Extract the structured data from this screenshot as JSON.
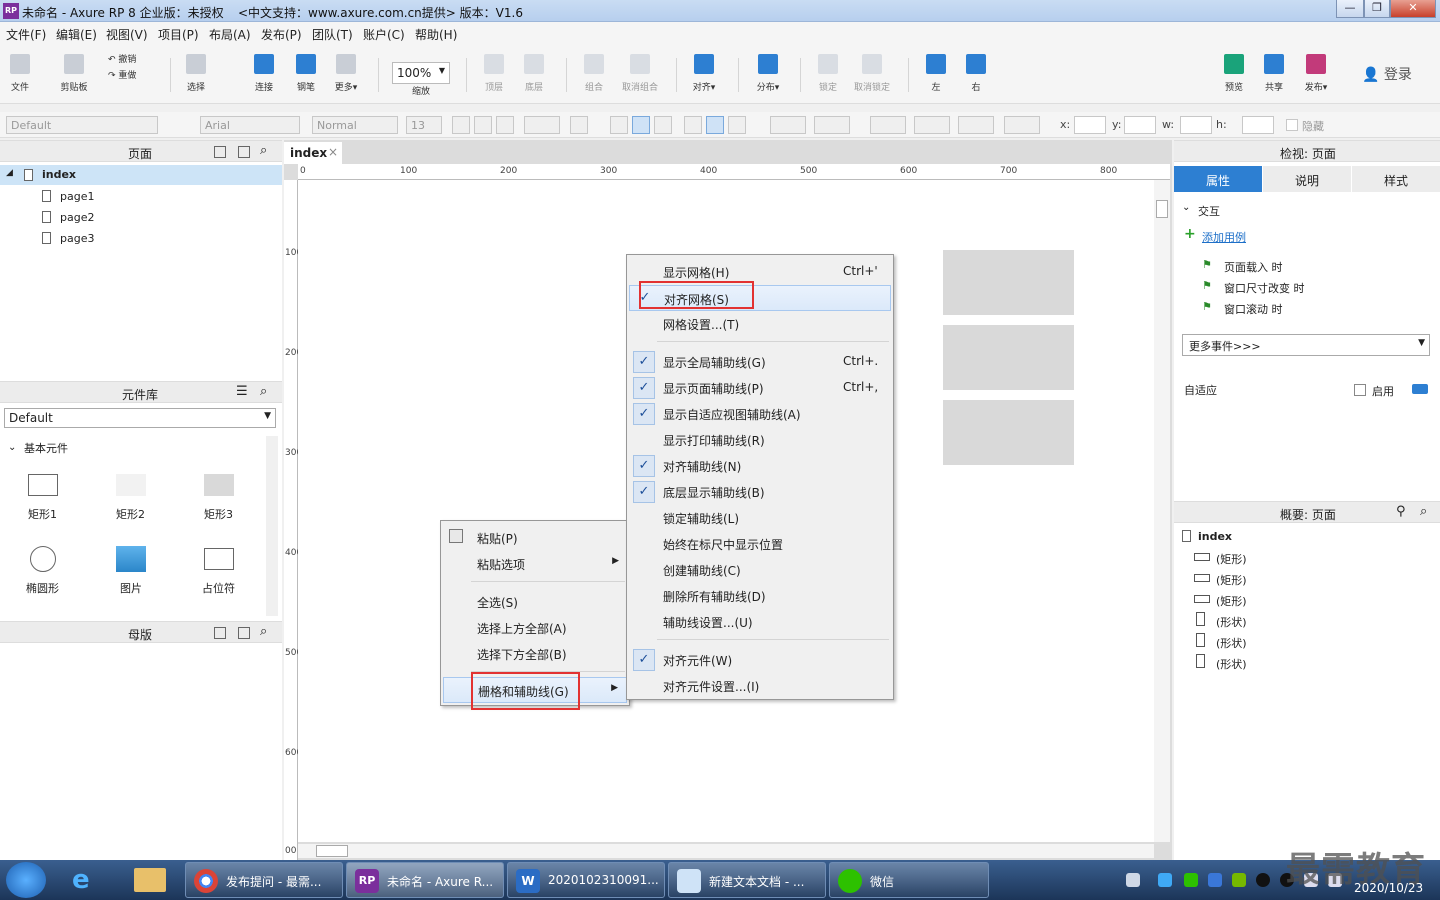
{
  "window": {
    "title": "未命名 - Axure RP 8 企业版：未授权",
    "subtitle": "<中文支持：www.axure.com.cn提供> 版本：V1.6",
    "logo": "RP"
  },
  "menu": [
    "文件(F)",
    "编辑(E)",
    "视图(V)",
    "项目(P)",
    "布局(A)",
    "发布(P)",
    "团队(T)",
    "账户(C)",
    "帮助(H)"
  ],
  "toolbar": {
    "file": "文件",
    "clipboard": "剪贴板",
    "undo": "撤销",
    "redo": "重做",
    "select": "选择",
    "connect": "连接",
    "pen": "钢笔",
    "more": "更多▾",
    "zoom": "100%",
    "zoom_label": "缩放",
    "top": "顶层",
    "bottom": "底层",
    "group": "组合",
    "ungroup": "取消组合",
    "align": "对齐▾",
    "distribute": "分布▾",
    "lock": "锁定",
    "unlock": "取消锁定",
    "left": "左",
    "right": "右",
    "preview": "预览",
    "share": "共享",
    "publish": "发布▾",
    "login": "登录"
  },
  "format": {
    "style": "Default",
    "font": "Arial",
    "weight": "Normal",
    "size": "13",
    "x": "x:",
    "y": "y:",
    "w": "w:",
    "h": "h:",
    "hide": "隐藏"
  },
  "pages": {
    "title": "页面",
    "root": "index",
    "children": [
      "page1",
      "page2",
      "page3"
    ]
  },
  "library": {
    "title": "元件库",
    "selected": "Default",
    "group": "基本元件",
    "items": [
      "矩形1",
      "矩形2",
      "矩形3",
      "椭圆形",
      "图片",
      "占位符"
    ]
  },
  "masters": {
    "title": "母版"
  },
  "canvas": {
    "tab": "index",
    "hticks": [
      "0",
      "100",
      "200",
      "300",
      "400",
      "500",
      "600",
      "700",
      "800"
    ],
    "vticks": [
      "100",
      "200",
      "300",
      "400",
      "500",
      "600",
      "00"
    ]
  },
  "context_menu": {
    "paste": "粘贴(P)",
    "paste_options": "粘贴选项",
    "select_all": "全选(S)",
    "select_above": "选择上方全部(A)",
    "select_below": "选择下方全部(B)",
    "grid_guides": "栅格和辅助线(G)"
  },
  "submenu": [
    {
      "label": "显示网格(H)",
      "shortcut": "Ctrl+'",
      "checked": false
    },
    {
      "label": "对齐网格(S)",
      "shortcut": "",
      "checked": true
    },
    {
      "label": "网格设置...(T)",
      "shortcut": "",
      "checked": false
    },
    {
      "label": "显示全局辅助线(G)",
      "shortcut": "Ctrl+.",
      "checked": true
    },
    {
      "label": "显示页面辅助线(P)",
      "shortcut": "Ctrl+,",
      "checked": true
    },
    {
      "label": "显示自适应视图辅助线(A)",
      "shortcut": "",
      "checked": true
    },
    {
      "label": "显示打印辅助线(R)",
      "shortcut": "",
      "checked": false
    },
    {
      "label": "对齐辅助线(N)",
      "shortcut": "",
      "checked": true
    },
    {
      "label": "底层显示辅助线(B)",
      "shortcut": "",
      "checked": true
    },
    {
      "label": "锁定辅助线(L)",
      "shortcut": "",
      "checked": false
    },
    {
      "label": "始终在标尺中显示位置",
      "shortcut": "",
      "checked": false
    },
    {
      "label": "创建辅助线(C)",
      "shortcut": "",
      "checked": false
    },
    {
      "label": "删除所有辅助线(D)",
      "shortcut": "",
      "checked": false
    },
    {
      "label": "辅助线设置...(U)",
      "shortcut": "",
      "checked": false
    },
    {
      "label": "对齐元件(W)",
      "shortcut": "",
      "checked": true
    },
    {
      "label": "对齐元件设置...(I)",
      "shortcut": "",
      "checked": false
    }
  ],
  "inspector": {
    "title": "检视: 页面",
    "tabs": [
      "属性",
      "说明",
      "样式"
    ],
    "interaction": "交互",
    "add_case": "添加用例",
    "events": [
      "页面载入 时",
      "窗口尺寸改变 时",
      "窗口滚动 时"
    ],
    "more_events": "更多事件>>>",
    "adaptive": "自适应",
    "enable": "启用"
  },
  "outline": {
    "title": "概要: 页面",
    "root": "index",
    "items": [
      "(矩形)",
      "(矩形)",
      "(矩形)",
      "(形状)",
      "(形状)",
      "(形状)"
    ]
  },
  "taskbar": {
    "tasks": [
      "发布提问 - 最需...",
      "未命名 - Axure R...",
      "2020102310091...",
      "新建文本文档 - ...",
      "微信"
    ],
    "watermark": "最需教育",
    "date": "2020/10/23"
  },
  "colors": {
    "accent": "#2d7fd2",
    "highlight": "#cde4f7",
    "red": "#e23232",
    "rect": "#d9d9d9"
  }
}
